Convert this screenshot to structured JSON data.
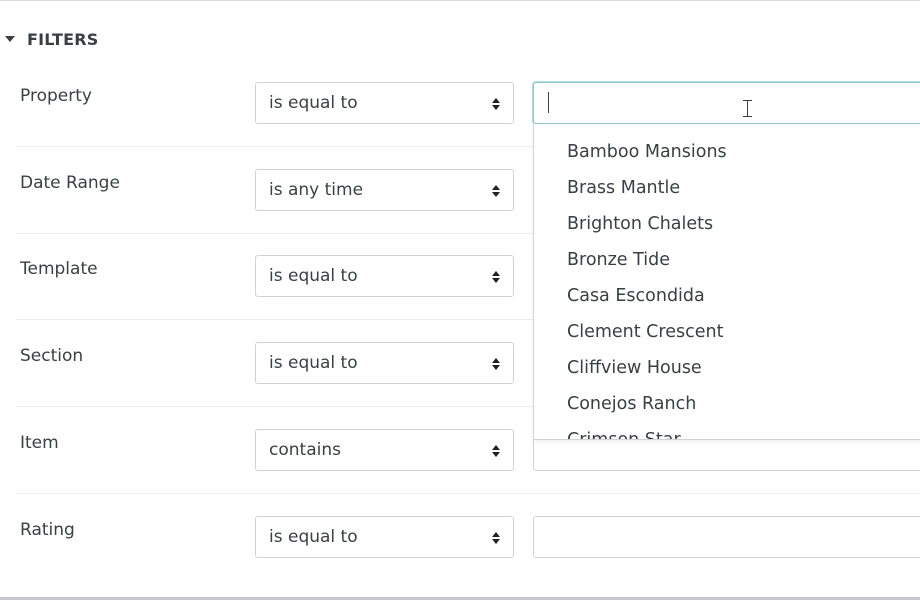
{
  "filters": {
    "title": "FILTERS"
  },
  "rows": [
    {
      "label": "Property",
      "operator": "is equal to",
      "value": ""
    },
    {
      "label": "Date Range",
      "operator": "is any time",
      "value": ""
    },
    {
      "label": "Template",
      "operator": "is equal to",
      "value": ""
    },
    {
      "label": "Section",
      "operator": "is equal to",
      "value": ""
    },
    {
      "label": "Item",
      "operator": "contains",
      "value": ""
    },
    {
      "label": "Rating",
      "operator": "is equal to",
      "value": ""
    }
  ],
  "property_dropdown": {
    "options": [
      "Bamboo Mansions",
      "Brass Mantle",
      "Brighton Chalets",
      "Bronze Tide",
      "Casa Escondida",
      "Clement Crescent",
      "Cliffview House",
      "Conejos Ranch",
      "Crimson Star"
    ]
  },
  "icons": {
    "header_toggle": "caret-down-icon",
    "select_arrows": "sort-icon",
    "mouse_cursor": "ibeam-cursor-icon"
  },
  "colors": {
    "text": "#3a3f44",
    "border": "#cfd3d7",
    "focus_border": "#8fc6cf"
  }
}
